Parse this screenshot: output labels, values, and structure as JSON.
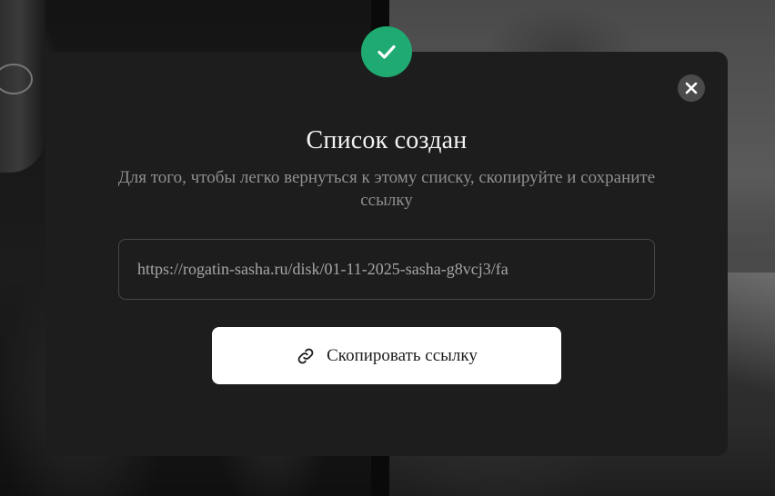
{
  "modal": {
    "title": "Список создан",
    "description": "Для того, чтобы легко вернуться к этому списку, скопируйте и сохраните ссылку",
    "link_value": "https://rogatin-sasha.ru/disk/01-11-2025-sasha-g8vcj3/fa",
    "copy_button_label": "Скопировать ссылку",
    "copy_button_icon": "link-icon",
    "close_icon": "close-icon",
    "status_icon": "checkmark-icon"
  },
  "colors": {
    "success": "#1faa72",
    "modal_bg": "#1d1d1d",
    "button_bg": "#ffffff",
    "close_bg": "#4b4b4b"
  }
}
